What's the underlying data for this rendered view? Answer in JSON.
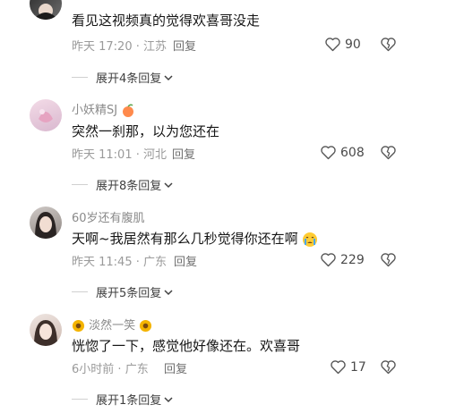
{
  "comments": [
    {
      "username": "",
      "text": "看见这视频真的觉得欢喜哥没走",
      "time": "昨天 17:20",
      "location": "江苏",
      "reply_label": "回复",
      "likes": "90",
      "expand_label": "展开4条回复"
    },
    {
      "username": "小妖精SJ",
      "text": "突然一刹那，以为您还在",
      "time": "昨天 11:01",
      "location": "河北",
      "reply_label": "回复",
      "likes": "608",
      "expand_label": "展开8条回复"
    },
    {
      "username": "60岁还有腹肌",
      "text": "天啊~我居然有那么几秒觉得你还在啊",
      "time": "昨天 11:45",
      "location": "广东",
      "reply_label": "回复",
      "likes": "229",
      "expand_label": "展开5条回复"
    },
    {
      "username": "淡然一笑",
      "text": "恍惚了一下，感觉他好像还在。欢喜哥",
      "time": "6小时前",
      "location": "广东",
      "reply_label": "回复",
      "likes": "17",
      "expand_label": "展开1条回复"
    }
  ],
  "meta_separator": " · ",
  "colors": {
    "heart_outline": "#555555",
    "sunflower": "#f4b400",
    "peach": "#ff8a4c"
  }
}
